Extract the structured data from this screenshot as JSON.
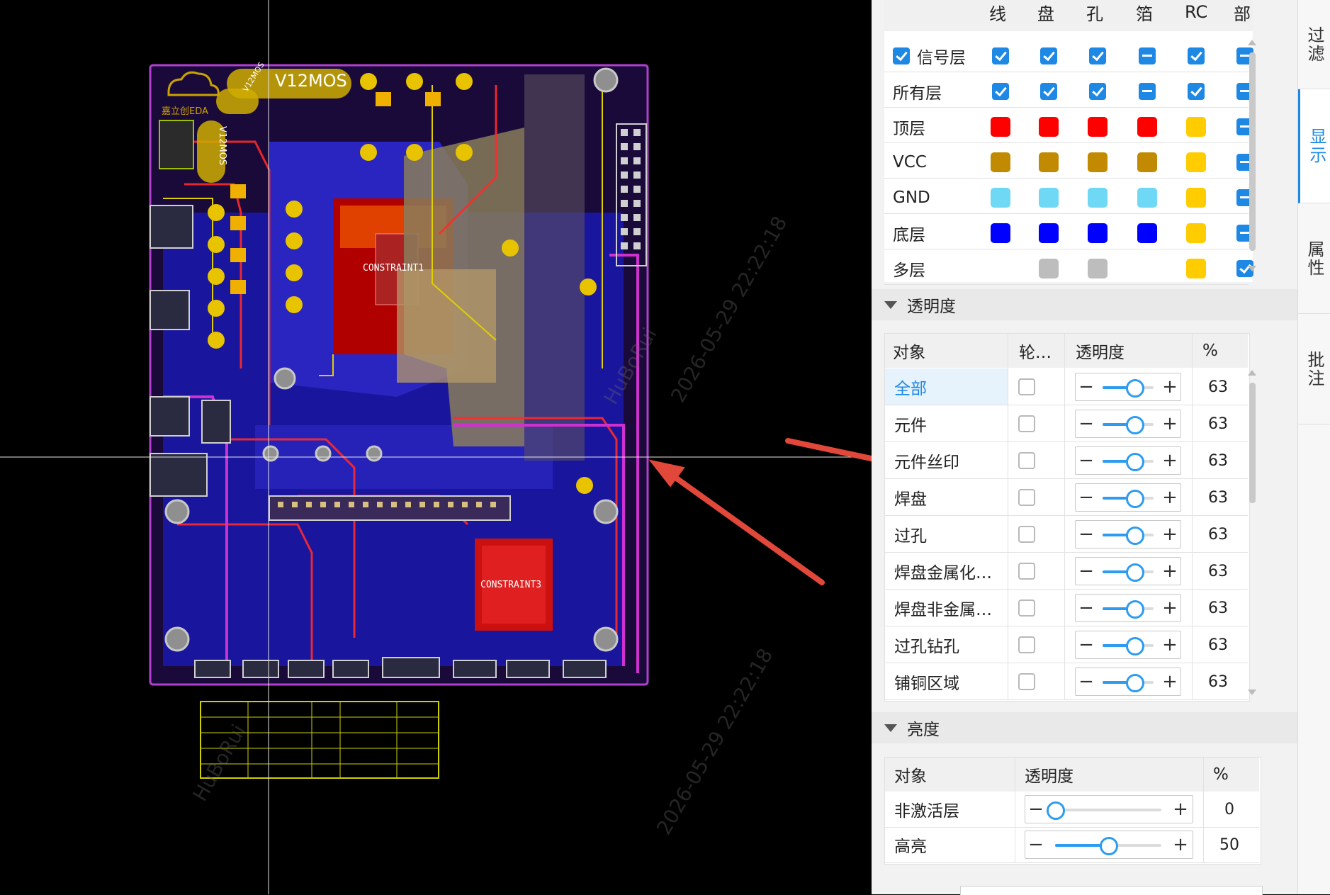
{
  "board": {
    "title_badge": "V12MOS",
    "small_badge": "V12MOS",
    "vertical_badge": "V12MOS",
    "logo_text": "嘉立创EDA",
    "constraint1": "CONSTRAINT1",
    "constraint3": "CONSTRAINT3",
    "watermark_lines": [
      "HuBoRui",
      "2026-05-29 22:22:18"
    ]
  },
  "top_header": [
    "线",
    "盘",
    "孔",
    "箔",
    "RC",
    "部"
  ],
  "layers": [
    {
      "name": "信号层",
      "has_checkbox": true,
      "cells": [
        "on",
        "on",
        "on",
        "mix",
        "on",
        "mix"
      ]
    },
    {
      "name": "所有层",
      "has_checkbox": false,
      "cells": [
        "on",
        "on",
        "on",
        "mix",
        "on",
        "mix"
      ]
    },
    {
      "name": "顶层",
      "colors": [
        "#ff0000",
        "#ff0000",
        "#ff0000",
        "#ff0000",
        "#ffcc00"
      ],
      "last": "mix"
    },
    {
      "name": "VCC",
      "colors": [
        "#c28a00",
        "#c28a00",
        "#c28a00",
        "#c28a00",
        "#ffcc00"
      ],
      "last": "mix"
    },
    {
      "name": "GND",
      "colors": [
        "#6fd8f5",
        "#6fd8f5",
        "#6fd8f5",
        "#6fd8f5",
        "#ffcc00"
      ],
      "last": "mix"
    },
    {
      "name": "底层",
      "colors": [
        "#0000ff",
        "#0000ff",
        "#0000ff",
        "#0000ff",
        "#ffcc00"
      ],
      "last": "mix"
    },
    {
      "name": "多层",
      "colors": [
        "",
        "#bdbdbd",
        "#bdbdbd",
        "",
        "#ffcc00"
      ],
      "last": "on"
    }
  ],
  "transparency": {
    "section_title": "透明度",
    "headers": [
      "对象",
      "轮…",
      "透明度",
      "%"
    ],
    "rows": [
      {
        "name": "全部",
        "value": "63",
        "active": true
      },
      {
        "name": "元件",
        "value": "63"
      },
      {
        "name": "元件丝印",
        "value": "63"
      },
      {
        "name": "焊盘",
        "value": "63"
      },
      {
        "name": "过孔",
        "value": "63"
      },
      {
        "name": "焊盘金属化…",
        "value": "63"
      },
      {
        "name": "焊盘非金属…",
        "value": "63"
      },
      {
        "name": "过孔钻孔",
        "value": "63"
      },
      {
        "name": "铺铜区域",
        "value": "63"
      }
    ]
  },
  "brightness": {
    "section_title": "亮度",
    "headers": [
      "对象",
      "透明度",
      "%"
    ],
    "rows": [
      {
        "name": "非激活层",
        "value": "0"
      },
      {
        "name": "高亮",
        "value": "50"
      }
    ]
  },
  "side_tabs": [
    "过滤",
    "显示",
    "属性",
    "批注"
  ],
  "colors": {
    "accent": "#1e88e5",
    "annotation_arrow": "#e2483a"
  }
}
